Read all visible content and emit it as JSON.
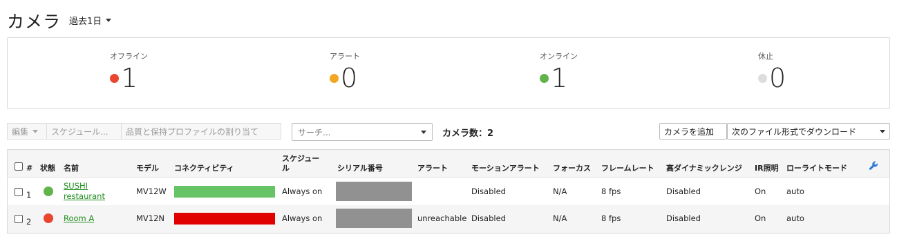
{
  "header": {
    "title": "カメラ",
    "period": "過去1日"
  },
  "summary": {
    "stats": [
      {
        "label": "オフライン",
        "value": "1",
        "color": "#e8462e"
      },
      {
        "label": "アラート",
        "value": "0",
        "color": "#f2a623"
      },
      {
        "label": "オンライン",
        "value": "1",
        "color": "#62b34a"
      },
      {
        "label": "休止",
        "value": "0",
        "color": "#dddddd"
      }
    ]
  },
  "toolbar": {
    "edit": "編集",
    "schedule": "スケジュール...",
    "quality": "品質と保持プロファイルの割り当て",
    "search_placeholder": "サーチ...",
    "camera_count": "カメラ数：2",
    "add_camera": "カメラを追加",
    "download": "次のファイル形式でダウンロード"
  },
  "table": {
    "headers": {
      "num": "#",
      "status": "状態",
      "name": "名前",
      "model": "モデル",
      "connectivity": "コネクティビティ",
      "schedule_l1": "スケジュー",
      "schedule_l2": "ル",
      "serial": "シリアル番号",
      "alert": "アラート",
      "motion_alert": "モーションアラート",
      "focus": "フォーカス",
      "frame_rate": "フレームレート",
      "hdr": "高ダイナミックレンジ",
      "ir": "IR照明",
      "lowlight": "ローライトモード"
    },
    "rows": [
      {
        "num": "1",
        "status_color": "#62b34a",
        "name_l1": "SUSHI",
        "name_l2": "restaurant",
        "model": "MV12W",
        "connectivity_color": "#66c466",
        "schedule": "Always on",
        "alert": "",
        "motion_alert": "Disabled",
        "focus": "N/A",
        "frame_rate": "8 fps",
        "hdr": "Disabled",
        "ir": "On",
        "lowlight": "auto"
      },
      {
        "num": "2",
        "status_color": "#e8462e",
        "name_l1": "Room A",
        "model": "MV12N",
        "connectivity_color": "#e00000",
        "schedule": "Always on",
        "alert": "unreachable",
        "motion_alert": "Disabled",
        "focus": "N/A",
        "frame_rate": "8 fps",
        "hdr": "Disabled",
        "ir": "On",
        "lowlight": "auto"
      }
    ]
  }
}
